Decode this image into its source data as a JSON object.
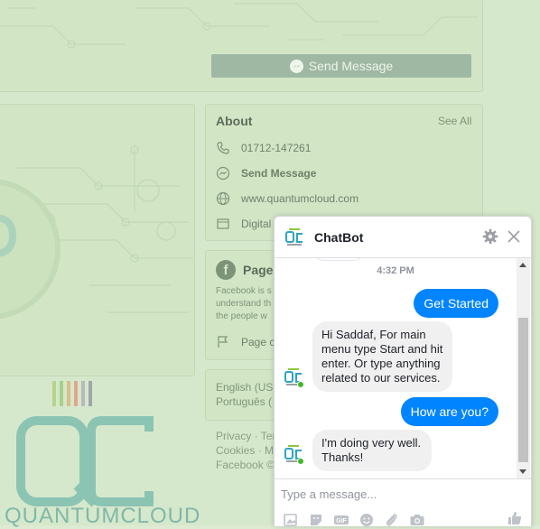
{
  "page": {
    "send_message_button": "Send Message",
    "about": {
      "title": "About",
      "see_all": "See All",
      "phone": "01712-147261",
      "send_message": "Send Message",
      "website": "www.quantumcloud.com",
      "category": "Digital"
    },
    "page_card": {
      "title": "Page",
      "text_lines": [
        "Facebook is s",
        "understand th",
        "the people w"
      ],
      "page_created": "Page cr"
    },
    "languages": {
      "english": "English (US",
      "portuguese": "Português ("
    },
    "footer": {
      "line1": "Privacy · Ter",
      "line2": "Cookies · M",
      "line3": "Facebook ©"
    },
    "logo": {
      "brand_text": "QUANTUMCLOUD",
      "stripe_colors": [
        "#b6d48c",
        "#a9cf8a",
        "#d7bf89",
        "#e0a58f",
        "#b9b9b9",
        "#9fa6ac"
      ]
    }
  },
  "chat": {
    "title": "ChatBot",
    "time": "4:32 PM",
    "messages": {
      "get_started": "Get Started",
      "bot_reply_1": "Hi Saddaf, For main menu type Start and hit enter. Or type anything related to our services.",
      "how_are_you": "How are you?",
      "bot_reply_2": "I'm doing very well. Thanks!"
    },
    "compose_placeholder": "Type a message...",
    "colors": {
      "accent": "#0084ff",
      "incoming_bubble": "#f1f0f0",
      "online": "#42b72a"
    }
  }
}
